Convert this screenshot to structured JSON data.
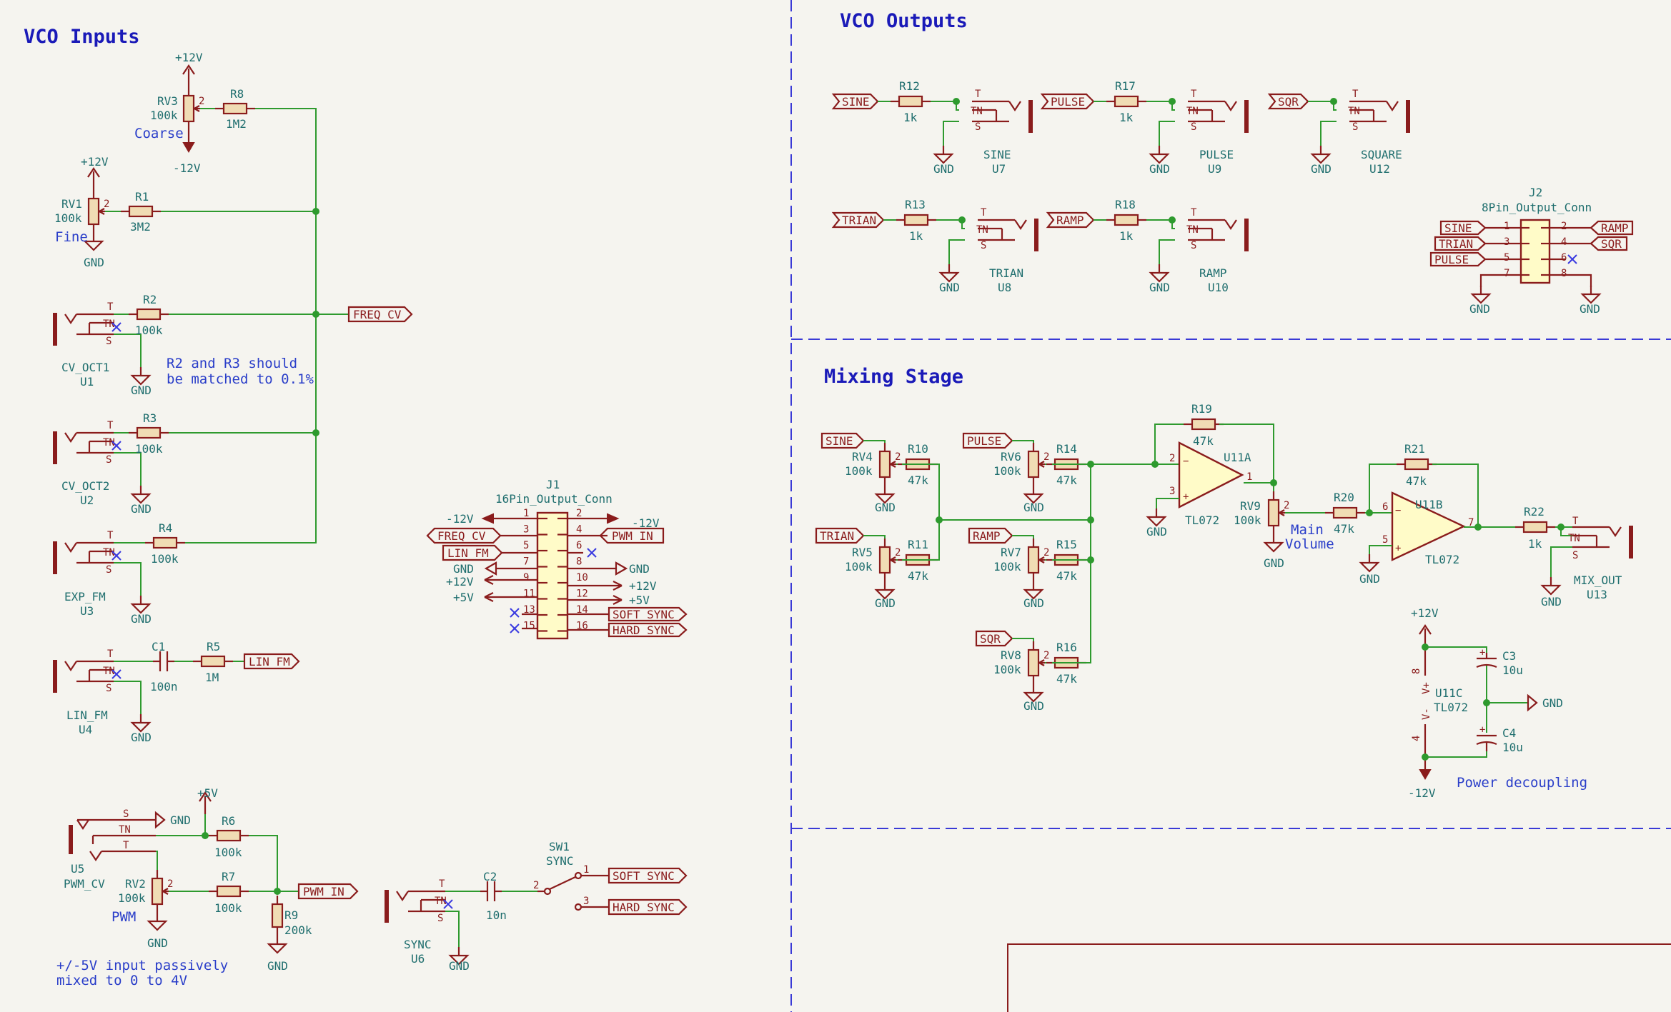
{
  "titles": {
    "vco_inputs": "VCO Inputs",
    "vco_outputs": "VCO Outputs",
    "mixing_stage": "Mixing Stage"
  },
  "notes": {
    "matched_1": "R2 and R3 should",
    "matched_2": "be matched to 0.1%",
    "pwm_1": "+/-5V input passively",
    "pwm_2": "mixed to 0 to 4V",
    "decoupling": "Power decoupling",
    "main_volume_1": "Main",
    "main_volume_2": "Volume",
    "coarse": "Coarse",
    "fine": "Fine",
    "pwm": "PWM"
  },
  "power": {
    "p12": "+12V",
    "m12": "-12V",
    "p5": "+5V",
    "gnd": "GND"
  },
  "pins": {
    "t": "T",
    "tn": "TN",
    "s": "S"
  },
  "pots": {
    "rv1": {
      "ref": "RV1",
      "value": "100k"
    },
    "rv2": {
      "ref": "RV2",
      "value": "100k"
    },
    "rv3": {
      "ref": "RV3",
      "value": "100k"
    },
    "rv4": {
      "ref": "RV4",
      "value": "100k"
    },
    "rv5": {
      "ref": "RV5",
      "value": "100k"
    },
    "rv6": {
      "ref": "RV6",
      "value": "100k"
    },
    "rv7": {
      "ref": "RV7",
      "value": "100k"
    },
    "rv8": {
      "ref": "RV8",
      "value": "100k"
    },
    "rv9": {
      "ref": "RV9",
      "value": "100k"
    }
  },
  "resistors": {
    "r1": {
      "ref": "R1",
      "value": "3M2"
    },
    "r2": {
      "ref": "R2",
      "value": "100k"
    },
    "r3": {
      "ref": "R3",
      "value": "100k"
    },
    "r4": {
      "ref": "R4",
      "value": "100k"
    },
    "r5": {
      "ref": "R5",
      "value": "1M"
    },
    "r6": {
      "ref": "R6",
      "value": "100k"
    },
    "r7": {
      "ref": "R7",
      "value": "100k"
    },
    "r8": {
      "ref": "R8",
      "value": "1M2"
    },
    "r9": {
      "ref": "R9",
      "value": "200k"
    },
    "r10": {
      "ref": "R10",
      "value": "47k"
    },
    "r11": {
      "ref": "R11",
      "value": "47k"
    },
    "r12": {
      "ref": "R12",
      "value": "1k"
    },
    "r13": {
      "ref": "R13",
      "value": "1k"
    },
    "r14": {
      "ref": "R14",
      "value": "47k"
    },
    "r15": {
      "ref": "R15",
      "value": "47k"
    },
    "r16": {
      "ref": "R16",
      "value": "47k"
    },
    "r17": {
      "ref": "R17",
      "value": "1k"
    },
    "r18": {
      "ref": "R18",
      "value": "1k"
    },
    "r19": {
      "ref": "R19",
      "value": "47k"
    },
    "r20": {
      "ref": "R20",
      "value": "47k"
    },
    "r21": {
      "ref": "R21",
      "value": "47k"
    },
    "r22": {
      "ref": "R22",
      "value": "1k"
    }
  },
  "caps": {
    "c1": {
      "ref": "C1",
      "value": "100n"
    },
    "c2": {
      "ref": "C2",
      "value": "10n"
    },
    "c3": {
      "ref": "C3",
      "value": "10u"
    },
    "c4": {
      "ref": "C4",
      "value": "10u"
    }
  },
  "jacks": {
    "u1": {
      "name": "CV_OCT1",
      "ref": "U1"
    },
    "u2": {
      "name": "CV_OCT2",
      "ref": "U2"
    },
    "u3": {
      "name": "EXP_FM",
      "ref": "U3"
    },
    "u4": {
      "name": "LIN_FM",
      "ref": "U4"
    },
    "u5": {
      "name": "PWM_CV",
      "ref": "U5"
    },
    "u6": {
      "name": "SYNC",
      "ref": "U6"
    },
    "u7": {
      "name": "SINE",
      "ref": "U7"
    },
    "u8": {
      "name": "TRIAN",
      "ref": "U8"
    },
    "u9": {
      "name": "PULSE",
      "ref": "U9"
    },
    "u10": {
      "name": "RAMP",
      "ref": "U10"
    },
    "u12": {
      "name": "SQUARE",
      "ref": "U12"
    },
    "u13": {
      "name": "MIX_OUT",
      "ref": "U13"
    }
  },
  "opamps": {
    "u11a": {
      "ref": "U11A",
      "value": "TL072"
    },
    "u11b": {
      "ref": "U11B",
      "value": "TL072"
    },
    "u11c": {
      "ref": "U11C",
      "value": "TL072"
    },
    "vplus": "V+",
    "vminus": "V-"
  },
  "switch": {
    "ref": "SW1",
    "name": "SYNC"
  },
  "labels": {
    "freq_cv": "FREQ_CV",
    "lin_fm": "LIN_FM",
    "pwm_in": "PWM_IN",
    "soft_sync": "SOFT_SYNC",
    "hard_sync": "HARD_SYNC",
    "sine": "SINE",
    "trian": "TRIAN",
    "pulse": "PULSE",
    "ramp": "RAMP",
    "sqr": "SQR"
  },
  "j1": {
    "ref": "J1",
    "name": "16Pin_Output_Conn",
    "left": [
      "-12V",
      "FREQ_CV",
      "LIN_FM",
      "GND",
      "+12V",
      "+5V"
    ],
    "right": [
      "-12V",
      "PWM_IN",
      "GND",
      "+12V",
      "+5V",
      "SOFT_SYNC",
      "HARD_SYNC"
    ],
    "pin_numbers": [
      "1",
      "2",
      "3",
      "4",
      "5",
      "6",
      "7",
      "8",
      "9",
      "10",
      "11",
      "12",
      "13",
      "14",
      "15",
      "16"
    ]
  },
  "j2": {
    "ref": "J2",
    "name": "8Pin_Output_Conn",
    "left": [
      "SINE",
      "TRIAN",
      "PULSE"
    ],
    "right": [
      "RAMP",
      "SQR"
    ],
    "pin_numbers": [
      "1",
      "2",
      "3",
      "4",
      "5",
      "6",
      "7",
      "8"
    ]
  },
  "colors": {
    "wire": "#2e9a2e",
    "component": "#8a1c1c",
    "reference_text": "#1f6e6e",
    "note_text": "#2a3ec9",
    "title_text": "#1a1ab8",
    "background": "#f5f4ef"
  }
}
